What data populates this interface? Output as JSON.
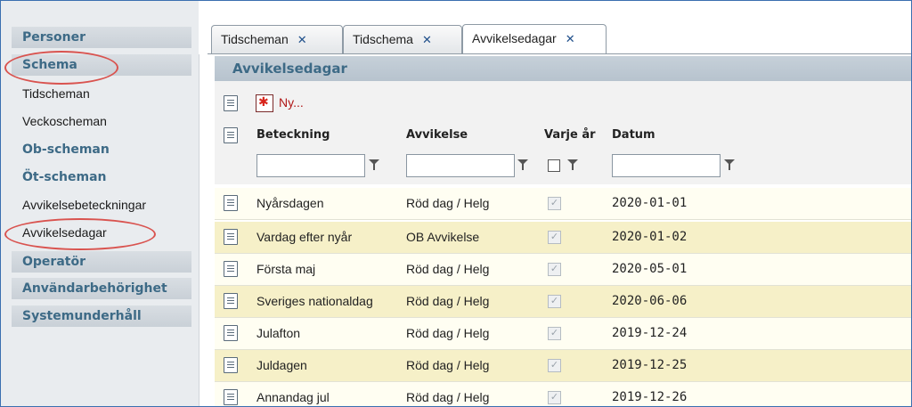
{
  "sidebar": {
    "items": [
      {
        "label": "Personer",
        "kind": "header"
      },
      {
        "label": "Schema",
        "kind": "header"
      },
      {
        "label": "Tidscheman",
        "kind": "link"
      },
      {
        "label": "Veckoscheman",
        "kind": "link"
      },
      {
        "label": "Ob-scheman",
        "kind": "sub"
      },
      {
        "label": "Öt-scheman",
        "kind": "sub"
      },
      {
        "label": "Avvikelsebeteckningar",
        "kind": "link"
      },
      {
        "label": "Avvikelsedagar",
        "kind": "link"
      },
      {
        "label": "Operatör",
        "kind": "header"
      },
      {
        "label": "Användarbehörighet",
        "kind": "header"
      },
      {
        "label": "Systemunderhåll",
        "kind": "header"
      }
    ]
  },
  "tabs": [
    {
      "label": "Tidscheman",
      "close": "✕",
      "active": false
    },
    {
      "label": "Tidschema",
      "close": "✕",
      "active": false
    },
    {
      "label": "Avvikelsedagar",
      "close": "✕",
      "active": true
    }
  ],
  "panel": {
    "title": "Avvikelsedagar",
    "new_label": "Ny...",
    "columns": {
      "beteckning": "Beteckning",
      "avvikelse": "Avvikelse",
      "varje_ar": "Varje år",
      "datum": "Datum"
    },
    "filters": {
      "beteckning": "",
      "avvikelse": "",
      "datum": ""
    }
  },
  "rows": [
    {
      "beteckning": "Nyårsdagen",
      "avvikelse": "Röd dag / Helg",
      "varje_ar": true,
      "datum": "2020-01-01"
    },
    {
      "beteckning": "Vardag efter nyår",
      "avvikelse": "OB Avvikelse",
      "varje_ar": true,
      "datum": "2020-01-02"
    },
    {
      "beteckning": "Första maj",
      "avvikelse": "Röd dag / Helg",
      "varje_ar": true,
      "datum": "2020-05-01"
    },
    {
      "beteckning": "Sveriges nationaldag",
      "avvikelse": "Röd dag / Helg",
      "varje_ar": true,
      "datum": "2020-06-06"
    },
    {
      "beteckning": "Julafton",
      "avvikelse": "Röd dag / Helg",
      "varje_ar": true,
      "datum": "2019-12-24"
    },
    {
      "beteckning": "Juldagen",
      "avvikelse": "Röd dag / Helg",
      "varje_ar": true,
      "datum": "2019-12-25"
    },
    {
      "beteckning": "Annandag jul",
      "avvikelse": "Röd dag / Helg",
      "varje_ar": true,
      "datum": "2019-12-26"
    }
  ],
  "icons": {
    "row": "document-icon",
    "new": "new-item-icon",
    "filter": "funnel-icon"
  },
  "colors": {
    "accent": "#3d6a86",
    "annotation": "#d9534f",
    "row_even": "#f6f0c8",
    "row_odd": "#fffef2"
  }
}
